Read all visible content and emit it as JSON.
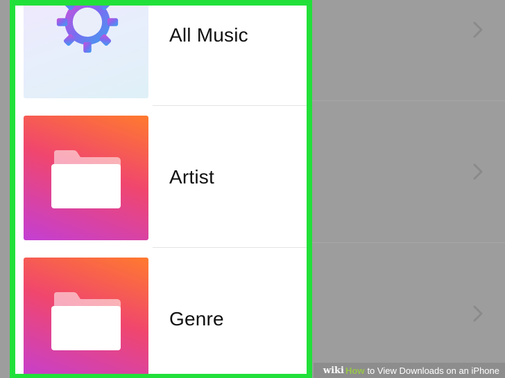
{
  "rows": [
    {
      "label": "All Music",
      "icon": "settings-gear-icon"
    },
    {
      "label": "Artist",
      "icon": "folder-icon"
    },
    {
      "label": "Genre",
      "icon": "folder-icon"
    }
  ],
  "watermark": {
    "brand_wiki": "wiki",
    "brand_how": "How",
    "title": "to View Downloads on an iPhone"
  },
  "colors": {
    "highlight_border": "#22e03a",
    "dim_overlay": "#9d9d9d",
    "folder_gradient": [
      "#ff7a2e",
      "#f0466e",
      "#c33fd4"
    ],
    "brand_green": "#98c54a"
  }
}
